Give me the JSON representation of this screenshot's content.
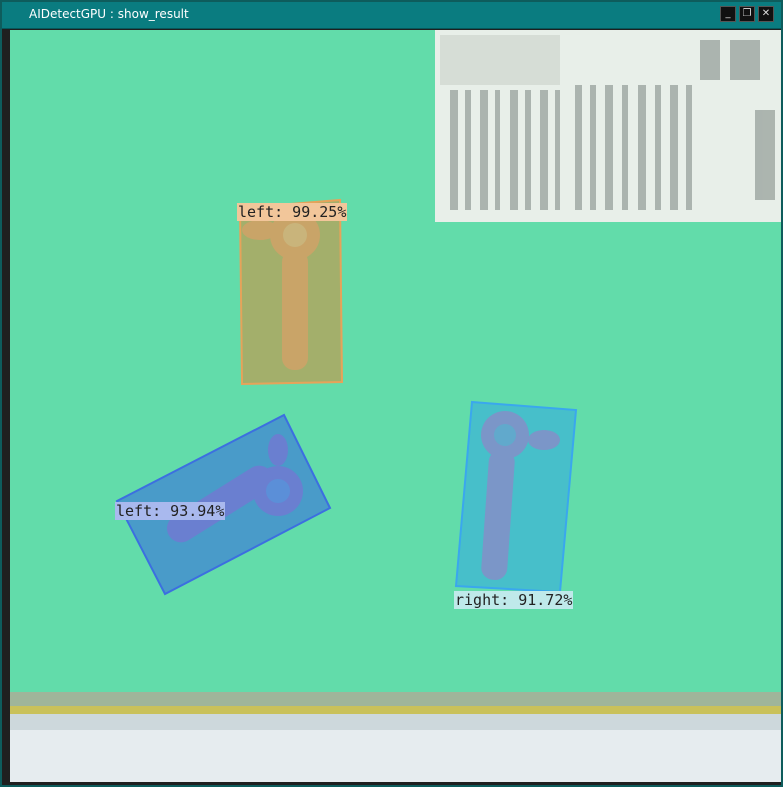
{
  "window": {
    "title": "AIDetectGPU : show_result",
    "controls": {
      "minimize": "_",
      "restore": "❐",
      "close": "✕"
    }
  },
  "detections": [
    {
      "label_text": "left: 99.25%",
      "class": "left",
      "confidence": 99.25,
      "color": "#e6a35a",
      "label_bg": "#f2c69a"
    },
    {
      "label_text": "left: 93.94%",
      "class": "left",
      "confidence": 93.94,
      "color": "#3c6fe0",
      "label_bg": "#a9b9ee"
    },
    {
      "label_text": "right: 91.72%",
      "class": "right",
      "confidence": 91.72,
      "color": "#3aa7ee",
      "label_bg": "#bfe9ea"
    }
  ],
  "colors": {
    "background_green": "#62dcaa",
    "titlebar": "#0a7c80"
  }
}
